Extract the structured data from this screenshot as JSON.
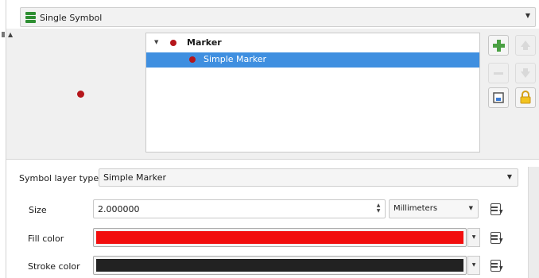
{
  "renderer": {
    "label": "Single Symbol"
  },
  "layer_tree": {
    "root_label": "Marker",
    "child_label": "Simple Marker"
  },
  "properties": {
    "symbol_layer_type_label": "Symbol layer type",
    "symbol_layer_type_value": "Simple Marker",
    "size_label": "Size",
    "size_value": "2.000000",
    "size_unit": "Millimeters",
    "fill_color_label": "Fill color",
    "stroke_color_label": "Stroke color"
  },
  "colors": {
    "fill": "#f20d0d",
    "stroke": "#222222",
    "marker": "#b5161b",
    "selection": "#3f8fe0"
  },
  "icons": {
    "renderer": "single-symbol-icon",
    "add_layer": "add-layer-icon",
    "remove_layer": "remove-layer-icon",
    "move_down": "move-down-icon",
    "duplicate": "duplicate-layer-icon",
    "lock": "lock-icon",
    "data_defined": "data-defined-override-icon"
  }
}
